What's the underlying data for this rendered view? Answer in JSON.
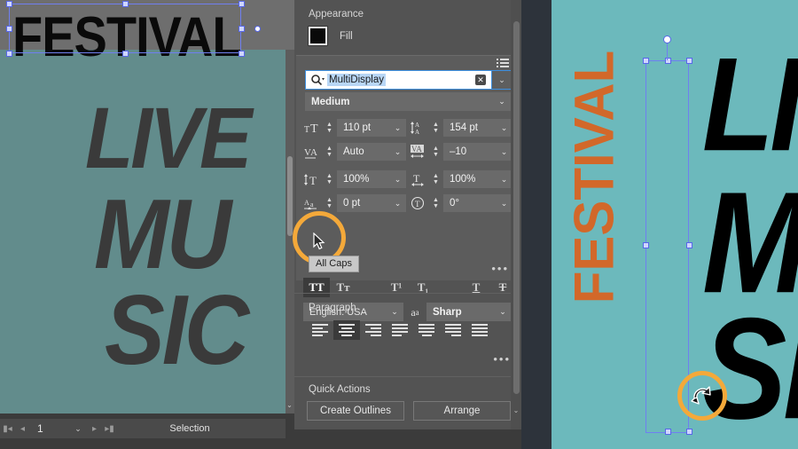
{
  "left_canvas": {
    "heading": "FESTIVAL",
    "art_lines": [
      "LIVE",
      "MU",
      "SIC"
    ],
    "status_bar": {
      "first_icon": "first-page-icon",
      "prev_icon": "previous-page-icon",
      "page_number": "1",
      "page_caret": "⌄",
      "next_icon": "next-page-icon",
      "last_icon": "last-page-icon",
      "tool_status": "Selection"
    },
    "scroll_arrow": "⌄"
  },
  "panel": {
    "appearance": {
      "title": "Appearance",
      "fill_label": "Fill",
      "fill_color": "#0a0a0a"
    },
    "character": {
      "list_icon": "font-list-icon",
      "search_icon": "font-search-icon",
      "font_family": "MultiDisplay",
      "clear_label": "✕",
      "caret": "⌄",
      "font_style": "Medium",
      "metrics": [
        {
          "icon": "font-size-icon",
          "value": "110 pt",
          "name": "font-size"
        },
        {
          "icon": "leading-icon",
          "value": "154 pt",
          "name": "leading"
        },
        {
          "icon": "kerning-icon",
          "value": "Auto",
          "name": "kerning"
        },
        {
          "icon": "tracking-icon",
          "value": "–10",
          "name": "tracking"
        },
        {
          "icon": "vertical-scale-icon",
          "value": "100%",
          "name": "vertical-scale"
        },
        {
          "icon": "horizontal-scale-icon",
          "value": "100%",
          "name": "horizontal-scale"
        },
        {
          "icon": "baseline-shift-icon",
          "value": "0 pt",
          "name": "baseline-shift"
        },
        {
          "icon": "character-rotation-icon",
          "value": "0°",
          "name": "character-rotation"
        }
      ],
      "type_styles": [
        {
          "label": "TT",
          "name": "all-caps",
          "active": true
        },
        {
          "label": "Tт",
          "name": "small-caps",
          "active": false
        },
        {
          "label": "T¹",
          "name": "superscript",
          "active": false
        },
        {
          "label": "T₁",
          "name": "subscript",
          "active": false
        },
        {
          "label": "T",
          "name": "underline",
          "active": false
        },
        {
          "label": "T",
          "name": "strikethrough",
          "active": false
        }
      ],
      "language": "English: USA",
      "antialias_icon": "anti-aliasing-icon",
      "antialias": "Sharp",
      "more_dots": "•••"
    },
    "paragraph": {
      "title": "Paragraph",
      "align_buttons": [
        {
          "name": "align-left",
          "active": false
        },
        {
          "name": "align-center",
          "active": true
        },
        {
          "name": "align-right",
          "active": false
        },
        {
          "name": "justify-last-left",
          "active": false
        },
        {
          "name": "justify-last-center",
          "active": false
        },
        {
          "name": "justify-last-right",
          "active": false
        },
        {
          "name": "justify-all",
          "active": false
        }
      ],
      "more_dots": "•••"
    },
    "quick_actions": {
      "title": "Quick Actions",
      "buttons": [
        {
          "label": "Create Outlines",
          "name": "create-outlines-button"
        },
        {
          "label": "Arrange",
          "name": "arrange-button"
        }
      ]
    },
    "tooltip": "All Caps",
    "scroll_arrow": "⌄"
  },
  "right_canvas": {
    "heading": "FESTIVAL",
    "art_lines": [
      "LIVE",
      "MU",
      "SIC"
    ],
    "heading_color": "#d2682a",
    "background_color": "#6cb9bc",
    "annotation_color": "#f4a93a"
  }
}
